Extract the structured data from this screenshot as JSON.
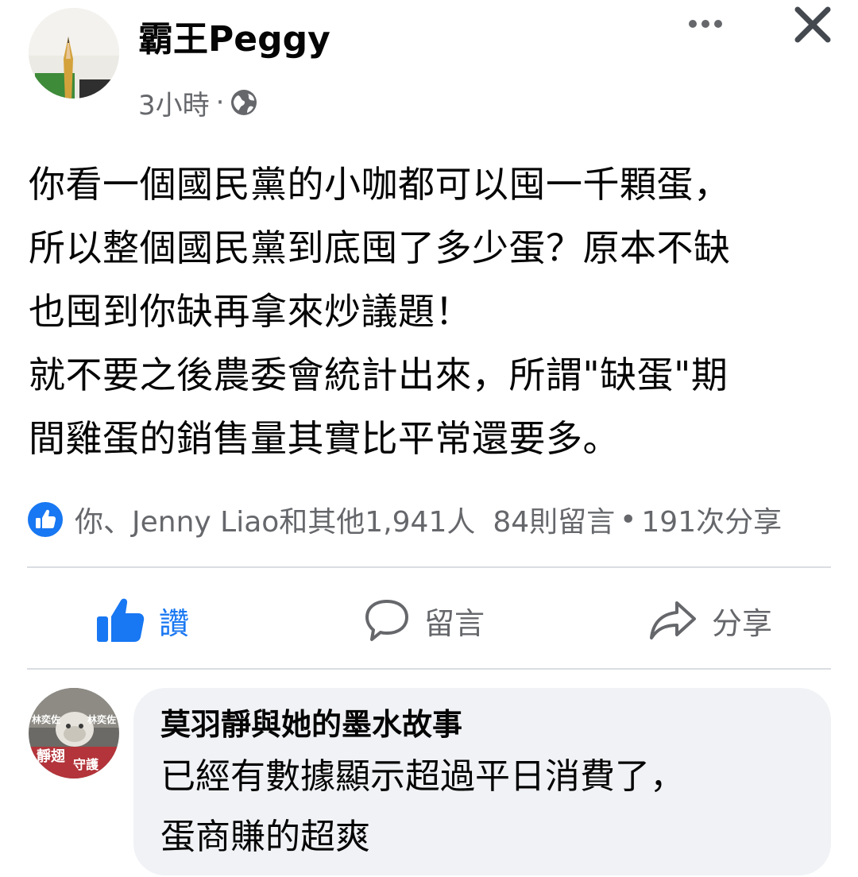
{
  "post": {
    "author": "霸王Peggy",
    "time": "3小時",
    "separator": "·",
    "privacy_icon": "globe-icon",
    "lines": [
      "你看一個國民黨的小咖都可以囤一千顆蛋，",
      "所以整個國民黨到底囤了多少蛋？原本不缺",
      "也囤到你缺再拿來炒議題！",
      "就不要之後農委會統計出來，所謂\"缺蛋\"期",
      "間雞蛋的銷售量其實比平常還要多。"
    ]
  },
  "header_icons": {
    "more": "more-horizontal-icon",
    "close": "close-icon"
  },
  "reactions": {
    "icon": "like-reaction-icon",
    "summary": "你、Jenny Liao和其他1,941人",
    "comments": "84則留言",
    "sep": "•",
    "shares": "191次分享"
  },
  "actions": {
    "like": "讚",
    "comment": "留言",
    "share": "分享"
  },
  "comment": {
    "author": "莫羽靜與她的墨水故事",
    "lines": [
      "已經有數據顯示超過平日消費了，",
      "蛋商賺的超爽"
    ],
    "avatar_lines": [
      "林奕佐",
      "林奕佐",
      "靜翅",
      "守護"
    ]
  },
  "colors": {
    "accent": "#1877f2",
    "secondary_text": "#65676b",
    "bubble": "#f0f2f5",
    "divider": "#dadde1"
  }
}
